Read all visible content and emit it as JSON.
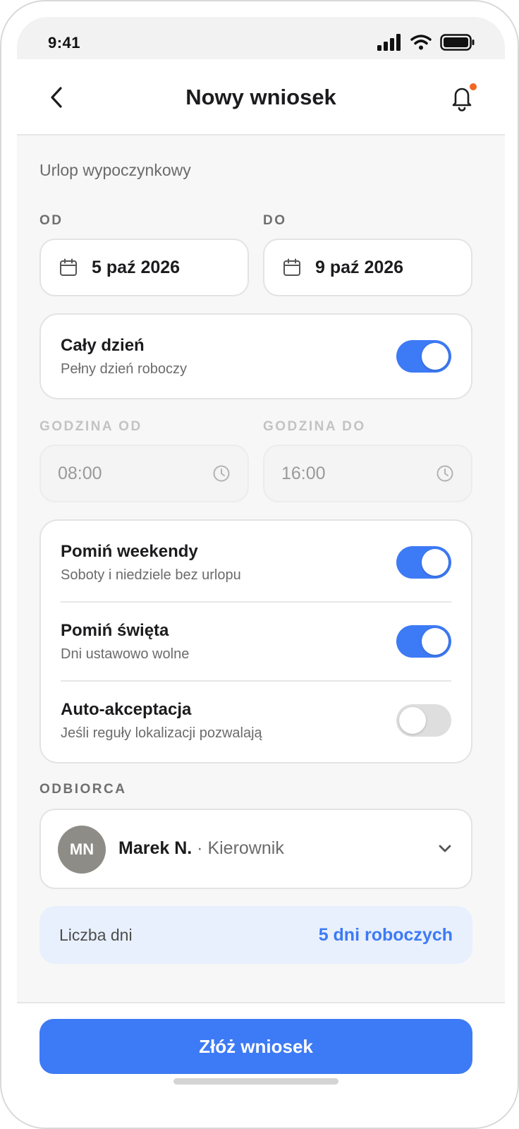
{
  "status_bar": {
    "time": "9:41"
  },
  "header": {
    "title": "Nowy wniosek"
  },
  "form": {
    "leave_type": "Urlop wypoczynkowy",
    "from_label": "OD",
    "to_label": "DO",
    "from_date": "5 paź 2026",
    "to_date": "9 paź 2026",
    "all_day": {
      "title": "Cały dzień",
      "subtitle": "Pełny dzień roboczy",
      "enabled": true
    },
    "time_from_label": "GODZINA OD",
    "time_to_label": "GODZINA DO",
    "time_from": "08:00",
    "time_to": "16:00",
    "options": [
      {
        "title": "Pomiń weekendy",
        "subtitle": "Soboty i niedziele bez urlopu",
        "enabled": true
      },
      {
        "title": "Pomiń święta",
        "subtitle": "Dni ustawowo wolne",
        "enabled": true
      },
      {
        "title": "Auto-akceptacja",
        "subtitle": "Jeśli reguły lokalizacji pozwalają",
        "enabled": false
      }
    ],
    "recipient_label": "ODBIORCA",
    "recipient": {
      "initials": "MN",
      "name": "Marek N.",
      "role": "· Kierownik"
    },
    "summary": {
      "label": "Liczba dni",
      "value": "5 dni roboczych"
    }
  },
  "footer": {
    "submit_label": "Złóż wniosek"
  },
  "colors": {
    "accent": "#3d7af5",
    "notification_dot": "#f26522",
    "summary_bg": "#e8f0fd"
  }
}
